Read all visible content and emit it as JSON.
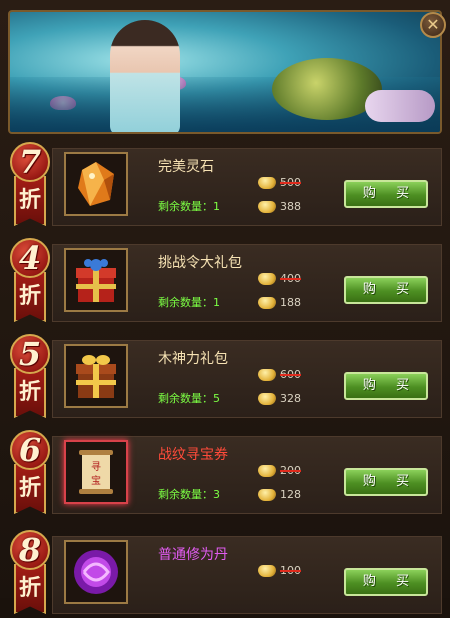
{
  "close_icon": "close-icon",
  "items": [
    {
      "discount": "7",
      "zhe": "折",
      "name": "完美灵石",
      "stock_label": "剩余数量：",
      "stock": "1",
      "old_price": "500",
      "new_price": "388",
      "buy": "购 买",
      "name_color": "#f6e2b3",
      "icon": "orange-gem-icon"
    },
    {
      "discount": "4",
      "zhe": "折",
      "name": "挑战令大礼包",
      "stock_label": "剩余数量：",
      "stock": "1",
      "old_price": "400",
      "new_price": "188",
      "buy": "购 买",
      "name_color": "#f6e2b3",
      "icon": "red-gift-box-icon"
    },
    {
      "discount": "5",
      "zhe": "折",
      "name": "木神力礼包",
      "stock_label": "剩余数量：",
      "stock": "5",
      "old_price": "600",
      "new_price": "328",
      "buy": "购 买",
      "name_color": "#f6e2b3",
      "icon": "gold-gift-box-icon"
    },
    {
      "discount": "6",
      "zhe": "折",
      "name": "战纹寻宝券",
      "stock_label": "剩余数量：",
      "stock": "3",
      "old_price": "200",
      "new_price": "128",
      "buy": "购 买",
      "name_color": "#ff4b3a",
      "icon": "treasure-scroll-icon"
    },
    {
      "discount": "8",
      "zhe": "折",
      "name": "普通修为丹",
      "stock_label": "剩余数量：",
      "stock": "",
      "old_price": "100",
      "new_price": "",
      "buy": "购 买",
      "name_color": "#e05cf0",
      "icon": "purple-orb-icon"
    }
  ]
}
